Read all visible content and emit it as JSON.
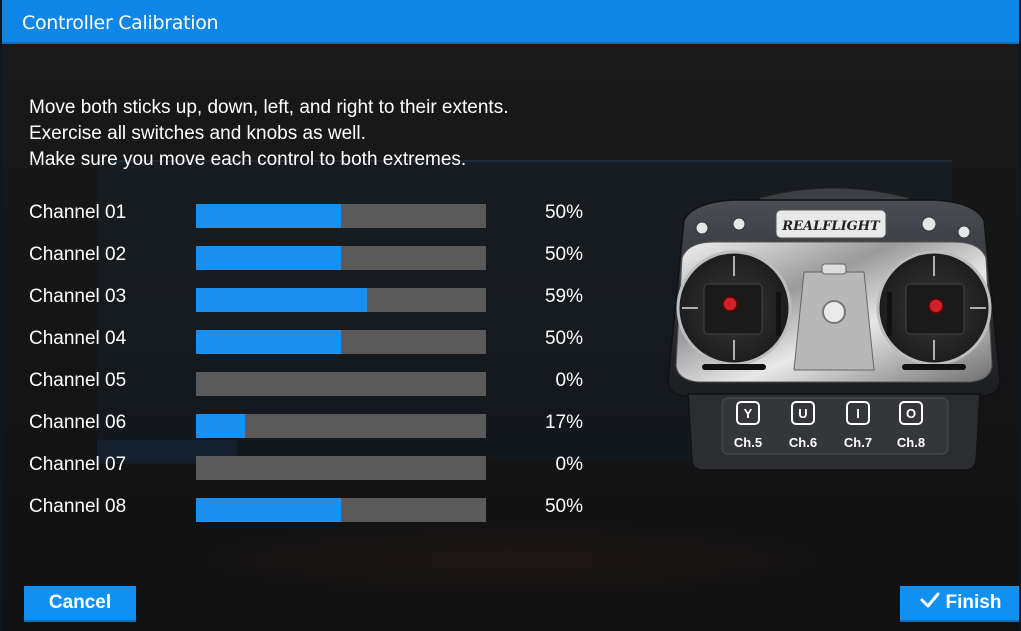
{
  "window": {
    "title": "Controller Calibration"
  },
  "instructions": [
    "Move both sticks up, down, left, and right to their extents.",
    "Exercise all switches and knobs as well.",
    "Make sure you move each control to both extremes."
  ],
  "channels": [
    {
      "label": "Channel 01",
      "percent_text": "50%",
      "fill": 0.5
    },
    {
      "label": "Channel 02",
      "percent_text": "50%",
      "fill": 0.5
    },
    {
      "label": "Channel 03",
      "percent_text": "59%",
      "fill": 0.59
    },
    {
      "label": "Channel 04",
      "percent_text": "50%",
      "fill": 0.5
    },
    {
      "label": "Channel 05",
      "percent_text": "0%",
      "fill": 0.0
    },
    {
      "label": "Channel 06",
      "percent_text": "17%",
      "fill": 0.17
    },
    {
      "label": "Channel 07",
      "percent_text": "0%",
      "fill": 0.0
    },
    {
      "label": "Channel 08",
      "percent_text": "50%",
      "fill": 0.5
    }
  ],
  "controller": {
    "brand": "REALFLIGHT",
    "keys": [
      {
        "key": "Y",
        "channel": "Ch.5"
      },
      {
        "key": "U",
        "channel": "Ch.6"
      },
      {
        "key": "I",
        "channel": "Ch.7"
      },
      {
        "key": "O",
        "channel": "Ch.8"
      }
    ]
  },
  "buttons": {
    "cancel": "Cancel",
    "finish": "Finish",
    "finish_icon": "checkmark-icon"
  },
  "colors": {
    "accent": "#1090f0",
    "bar_track": "#5a5a5a",
    "bar_fill": "#1a8ff0",
    "background": "#141414"
  }
}
